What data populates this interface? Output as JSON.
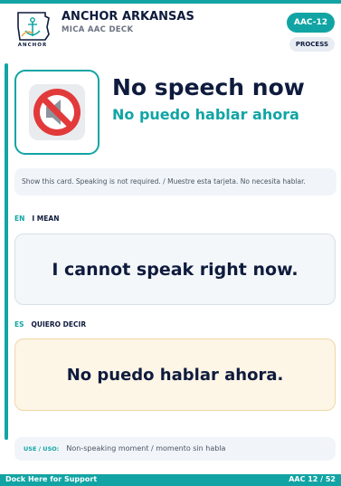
{
  "brand": {
    "logo_text": "ANCHOR",
    "name": "ANCHOR ARKANSAS",
    "deck": "MICA AAC DECK"
  },
  "badges": {
    "code": "AAC-12",
    "process": "PROCESS"
  },
  "card": {
    "icon": "muted-speaker-icon",
    "title_en": "No speech now",
    "title_es": "No puedo hablar ahora",
    "instructions": "Show this card. Speaking is not required. / Muestre esta tarjeta. No necesita hablar."
  },
  "sections": {
    "en": {
      "lang": "EN",
      "label": "I MEAN",
      "text": "I cannot speak right now."
    },
    "es": {
      "lang": "ES",
      "label": "QUIERO DECIR",
      "text": "No puedo hablar ahora."
    }
  },
  "use": {
    "label": "USE / USO:",
    "text": "Non-speaking moment / momento sin habla"
  },
  "footer": {
    "left": "Dock Here for Support",
    "right": "AAC 12 / 52"
  },
  "colors": {
    "accent": "#12a4a4",
    "navy": "#0f1b3d",
    "prohibited_red": "#e23a3a"
  }
}
